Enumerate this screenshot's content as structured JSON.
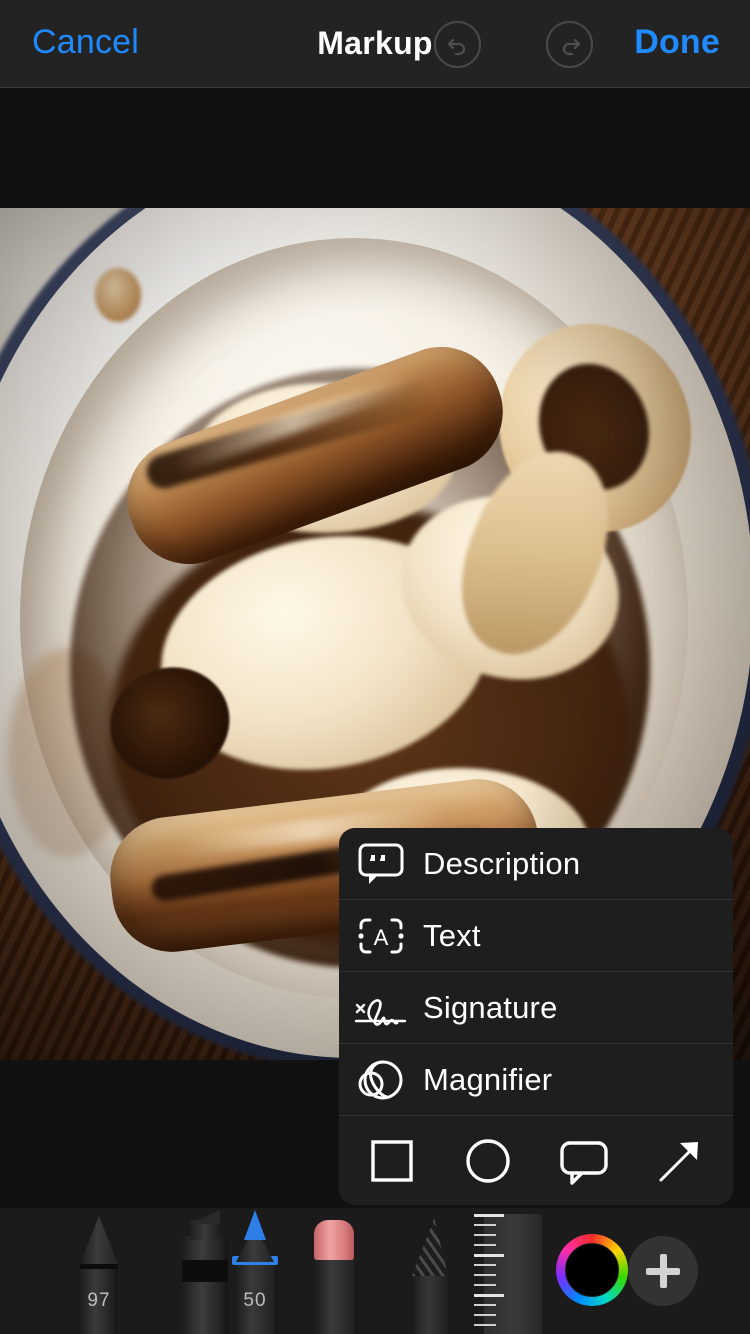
{
  "navbar": {
    "cancel_label": "Cancel",
    "title": "Markup",
    "done_label": "Done",
    "undo_icon": "undo-icon",
    "redo_icon": "redo-icon",
    "accent_color": "#1f8aff",
    "background": "#232323"
  },
  "photo": {
    "alt": "Sausages and mashed potato with gravy in a white bowl",
    "background": "#111111"
  },
  "markup_menu": {
    "background": "#1e1e1e",
    "items": [
      {
        "label": "Description",
        "icon": "speech-bubble-quote-icon"
      },
      {
        "label": "Text",
        "icon": "text-box-a-icon"
      },
      {
        "label": "Signature",
        "icon": "signature-icon"
      },
      {
        "label": "Magnifier",
        "icon": "magnifier-icon"
      }
    ],
    "shapes": [
      {
        "name": "square",
        "icon": "square-icon"
      },
      {
        "name": "circle",
        "icon": "circle-icon"
      },
      {
        "name": "speech-bubble",
        "icon": "speech-bubble-icon"
      },
      {
        "name": "arrow",
        "icon": "arrow-icon"
      }
    ]
  },
  "toolbar": {
    "background": "#1b1b1b",
    "tools": [
      {
        "name": "pen",
        "value": "97"
      },
      {
        "name": "marker",
        "value": ""
      },
      {
        "name": "highlighter-pen",
        "value": "50",
        "selected": true,
        "color": "#2f7fe8"
      },
      {
        "name": "eraser",
        "value": "",
        "color": "#f0a2a2"
      },
      {
        "name": "pencil",
        "value": ""
      },
      {
        "name": "ruler",
        "value": ""
      }
    ],
    "color_wheel": {
      "name": "color-picker",
      "selected_color": "#000000"
    },
    "add_button": {
      "name": "add-button",
      "label": "+"
    }
  }
}
